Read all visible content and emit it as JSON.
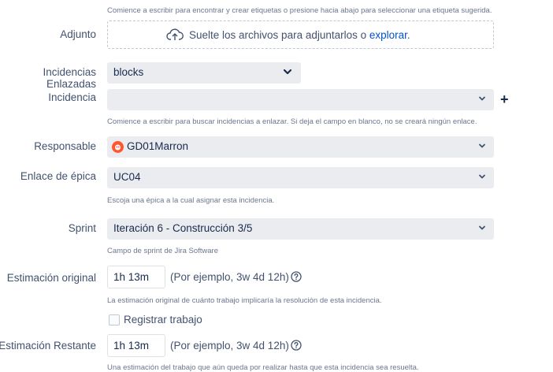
{
  "labels_help": {
    "top": "Comience a escribir para encontrar y crear etiquetas o presione hacia abajo para seleccionar una etiqueta sugerida."
  },
  "attachment": {
    "label": "Adjunto",
    "drop_text": "Suelte los archivos para adjuntarlos o ",
    "browse_link": "explorar",
    "period": "."
  },
  "linked_issues": {
    "label": "Incidencias Enlazadas",
    "label_line1": "Incidencias",
    "label_line2": "Enlazadas",
    "type_value": "blocks"
  },
  "issue": {
    "label": "Incidencia",
    "value": "",
    "help": "Comience a escribir para buscar incidencias a enlazar. Si deja el campo en blanco, no se creará ningún enlace."
  },
  "assignee": {
    "label": "Responsable",
    "value": "GD01Marron"
  },
  "epic_link": {
    "label": "Enlace de épica",
    "value": "UC04",
    "help": "Escoja una épica a la cual asignar esta incidencia."
  },
  "sprint": {
    "label": "Sprint",
    "value": "Iteración 6 - Construcción 3/5",
    "help": "Campo de sprint de Jira Software"
  },
  "original_estimate": {
    "label": "Estimación original",
    "value": "1h 13m",
    "hint": "(Por ejemplo, 3w 4d 12h)",
    "help": "La estimación original de cuánto trabajo implicaría la resolución de esta incidencia."
  },
  "log_work": {
    "label": "Registrar trabajo",
    "checked": false
  },
  "remaining_estimate": {
    "label": "Estimación Restante",
    "value": "1h 13m",
    "hint": "(Por ejemplo, 3w 4d 12h)",
    "help": "Una estimación del trabajo que aún queda por realizar hasta que esta incidencia sea resuelta."
  },
  "colors": {
    "field_bg": "#ebecf0",
    "link": "#0052cc",
    "label": "#42526e",
    "help": "#6b778c",
    "avatar": "#ff5630"
  }
}
